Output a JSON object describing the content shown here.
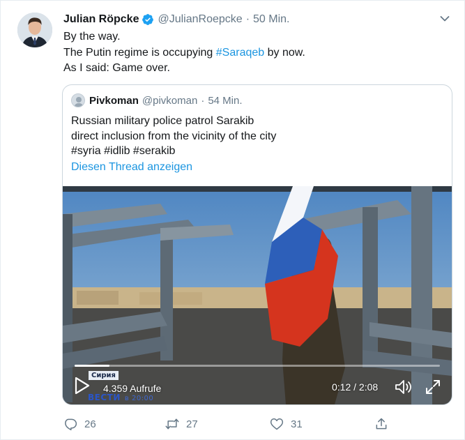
{
  "tweet": {
    "author_name": "Julian Röpcke",
    "handle": "@JulianRoepcke",
    "separator": "·",
    "time": "50 Min.",
    "lines": [
      {
        "text": "By the way."
      },
      {
        "pre": "The Putin regime is occupying ",
        "hashtag": "#Saraqeb",
        "post": " by now."
      },
      {
        "text": "As I said: Game over."
      }
    ]
  },
  "quote": {
    "author_name": "Pivkoman",
    "handle": "@pivkoman",
    "separator": "·",
    "time": "54 Min.",
    "lines": [
      "Russian military police patrol Sarakib",
      "direct inclusion from the vicinity of the city",
      "#syria #idlib #serakib"
    ],
    "thread_link": "Diesen Thread anzeigen"
  },
  "video": {
    "views": "4.359 Aufrufe",
    "timecode": "0:12 / 2:08",
    "progress_fraction": 0.095,
    "channel_caption": "Сирия",
    "channel_logo": "ВЕСТИ",
    "channel_time": "в 20:00"
  },
  "actions": {
    "replies": "26",
    "retweets": "27",
    "likes": "31"
  },
  "colors": {
    "accent": "#1b95e0",
    "verified": "#1da1f2",
    "muted": "#657786"
  },
  "icons": {
    "verified": "verified-badge-icon",
    "caret": "chevron-down-icon",
    "play": "play-icon",
    "volume": "volume-icon",
    "fullscreen": "fullscreen-icon",
    "reply": "reply-icon",
    "retweet": "retweet-icon",
    "like": "heart-icon",
    "share": "share-icon"
  }
}
